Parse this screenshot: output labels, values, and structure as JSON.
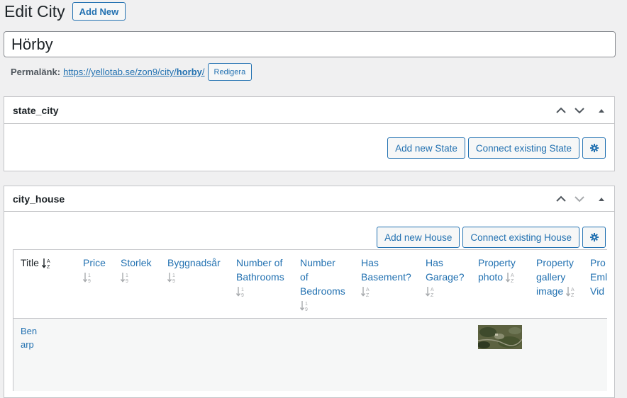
{
  "header": {
    "title": "Edit City",
    "add_new_label": "Add New"
  },
  "post_title": {
    "value": "Hörby"
  },
  "permalink": {
    "label": "Permalänk:",
    "url_prefix": "https://yellotab.se/zon9/city/",
    "slug": "horby",
    "url_suffix": "/",
    "edit_label": "Redigera"
  },
  "boxes": {
    "state_city": {
      "title": "state_city",
      "add_label": "Add new State",
      "connect_label": "Connect existing State"
    },
    "city_house": {
      "title": "city_house",
      "add_label": "Add new House",
      "connect_label": "Connect existing House",
      "columns": [
        {
          "key": "title",
          "lines": [
            "Title"
          ],
          "sort": "az",
          "active": true
        },
        {
          "key": "price",
          "lines": [
            "Price"
          ],
          "sort": "19"
        },
        {
          "key": "storlek",
          "lines": [
            "Storlek"
          ],
          "sort": "19"
        },
        {
          "key": "byggnadsar",
          "lines": [
            "Byggnadsår"
          ],
          "sort": "19"
        },
        {
          "key": "bathrooms",
          "lines": [
            "Number of",
            "Bathrooms"
          ],
          "sort": "19"
        },
        {
          "key": "bedrooms",
          "lines": [
            "Number",
            "of",
            "Bedrooms"
          ],
          "sort": "19"
        },
        {
          "key": "basement",
          "lines": [
            "Has",
            "Basement?"
          ],
          "sort": "az"
        },
        {
          "key": "garage",
          "lines": [
            "Has",
            "Garage?"
          ],
          "sort": "az"
        },
        {
          "key": "photo",
          "lines": [
            "Property",
            "photo"
          ],
          "sort": "az",
          "sort_inline": true
        },
        {
          "key": "gallery",
          "lines": [
            "Property",
            "gallery",
            "image"
          ],
          "sort": "az",
          "sort_inline": true
        },
        {
          "key": "embed",
          "lines": [
            "Pro",
            "Eml",
            "Vid"
          ],
          "sort": "none"
        }
      ],
      "rows": [
        {
          "title": "Benarp",
          "title_lines": [
            "Ben",
            "arp"
          ],
          "has_photo": true
        }
      ]
    }
  },
  "colors": {
    "accent": "#2271b1",
    "border": "#c3c4c7",
    "background": "#f0f0f1"
  }
}
